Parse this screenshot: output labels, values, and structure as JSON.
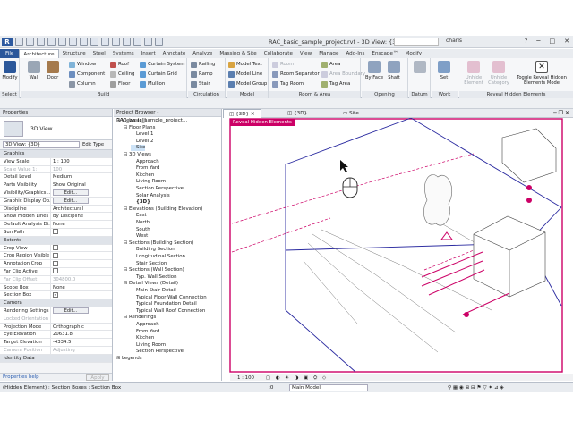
{
  "window": {
    "title": "RAC_basic_sample_project.rvt - 3D View: {3D}",
    "user": "charls",
    "search_placeholder": ""
  },
  "tabs": [
    "File",
    "Architecture",
    "Structure",
    "Steel",
    "Systems",
    "Insert",
    "Annotate",
    "Analyze",
    "Massing & Site",
    "Collaborate",
    "View",
    "Manage",
    "Add-Ins",
    "Enscape™",
    "Modify"
  ],
  "ribbon": {
    "select_panel": {
      "modify": "Modify",
      "select": "Select ▾"
    },
    "build": {
      "label": "Build",
      "wall": "Wall",
      "door": "Door",
      "window": "Window",
      "component": "Component",
      "column": "Column",
      "roof": "Roof",
      "ceiling": "Ceiling",
      "floor": "Floor",
      "curtain_system": "Curtain System",
      "curtain_grid": "Curtain Grid",
      "mullion": "Mullion"
    },
    "circulation": {
      "label": "Circulation",
      "railing": "Railing",
      "ramp": "Ramp",
      "stair": "Stair"
    },
    "model": {
      "label": "Model",
      "text": "Model Text",
      "line": "Model Line",
      "group": "Model Group"
    },
    "room_area": {
      "label": "Room & Area",
      "room": "Room",
      "room_separator": "Room Separator",
      "tag_room": "Tag Room",
      "area": "Area",
      "area_boundary": "Area Boundary",
      "tag_area": "Tag Area"
    },
    "opening": {
      "label": "Opening",
      "by_face": "By Face",
      "shaft": "Shaft"
    },
    "datum": {
      "label": "Datum"
    },
    "work_plane": {
      "label": "Work Plane",
      "set": "Set"
    },
    "reveal": {
      "label": "Reveal Hidden Elements",
      "unhide_element": "Unhide Element",
      "unhide_category": "Unhide Category",
      "toggle": "Toggle Reveal Hidden Elements Mode"
    }
  },
  "properties": {
    "title": "Properties",
    "type_name": "3D View",
    "selector": "3D View: {3D}",
    "edit_type": "Edit Type",
    "rows": [
      {
        "k": "Graphics",
        "section": true
      },
      {
        "k": "View Scale",
        "v": "1 : 100"
      },
      {
        "k": "Scale Value    1:",
        "v": "100",
        "grey": true
      },
      {
        "k": "Detail Level",
        "v": "Medium"
      },
      {
        "k": "Parts Visibility",
        "v": "Show Original"
      },
      {
        "k": "Visibility/Graphics ...",
        "v": "Edit...",
        "btn": true
      },
      {
        "k": "Graphic Display Op...",
        "v": "Edit...",
        "btn": true
      },
      {
        "k": "Discipline",
        "v": "Architectural"
      },
      {
        "k": "Show Hidden Lines",
        "v": "By Discipline"
      },
      {
        "k": "Default Analysis Di...",
        "v": "None"
      },
      {
        "k": "Sun Path",
        "cb": false
      },
      {
        "k": "Extents",
        "section": true
      },
      {
        "k": "Crop View",
        "cb": false
      },
      {
        "k": "Crop Region Visible",
        "cb": false
      },
      {
        "k": "Annotation Crop",
        "cb": false
      },
      {
        "k": "Far Clip Active",
        "cb": false
      },
      {
        "k": "Far Clip Offset",
        "v": "304800.0",
        "grey": true
      },
      {
        "k": "Scope Box",
        "v": "None"
      },
      {
        "k": "Section Box",
        "cb": true
      },
      {
        "k": "Camera",
        "section": true
      },
      {
        "k": "Rendering Settings",
        "v": "Edit...",
        "btn": true
      },
      {
        "k": "Locked Orientation",
        "v": "",
        "grey": true
      },
      {
        "k": "Projection Mode",
        "v": "Orthographic"
      },
      {
        "k": "Eye Elevation",
        "v": "20631.8"
      },
      {
        "k": "Target Elevation",
        "v": "-4334.5"
      },
      {
        "k": "Camera Position",
        "v": "Adjusting",
        "grey": true
      },
      {
        "k": "Identity Data",
        "section": true
      }
    ],
    "help": "Properties help",
    "apply": "Apply"
  },
  "browser": {
    "title": "Project Browser - RAC_basic_sample_project...",
    "nodes": [
      {
        "t": "Views (all)",
        "lvl": 0,
        "tg": "⊟"
      },
      {
        "t": "Floor Plans",
        "lvl": 1,
        "tg": "⊟"
      },
      {
        "t": "Level 1",
        "lvl": 2
      },
      {
        "t": "Level 2",
        "lvl": 2
      },
      {
        "t": "Site",
        "lvl": 2,
        "sel": true
      },
      {
        "t": "3D Views",
        "lvl": 1,
        "tg": "⊟"
      },
      {
        "t": "Approach",
        "lvl": 2
      },
      {
        "t": "From Yard",
        "lvl": 2
      },
      {
        "t": "Kitchen",
        "lvl": 2
      },
      {
        "t": "Living Room",
        "lvl": 2
      },
      {
        "t": "Section Perspective",
        "lvl": 2
      },
      {
        "t": "Solar Analysis",
        "lvl": 2
      },
      {
        "t": "{3D}",
        "lvl": 2,
        "bold": true
      },
      {
        "t": "Elevations (Building Elevation)",
        "lvl": 1,
        "tg": "⊟"
      },
      {
        "t": "East",
        "lvl": 2
      },
      {
        "t": "North",
        "lvl": 2
      },
      {
        "t": "South",
        "lvl": 2
      },
      {
        "t": "West",
        "lvl": 2
      },
      {
        "t": "Sections (Building Section)",
        "lvl": 1,
        "tg": "⊟"
      },
      {
        "t": "Building Section",
        "lvl": 2
      },
      {
        "t": "Longitudinal Section",
        "lvl": 2
      },
      {
        "t": "Stair Section",
        "lvl": 2
      },
      {
        "t": "Sections (Wall Section)",
        "lvl": 1,
        "tg": "⊟"
      },
      {
        "t": "Typ. Wall Section",
        "lvl": 2
      },
      {
        "t": "Detail Views (Detail)",
        "lvl": 1,
        "tg": "⊟"
      },
      {
        "t": "Main Stair Detail",
        "lvl": 2
      },
      {
        "t": "Typical Floor Wall Connection",
        "lvl": 2
      },
      {
        "t": "Typical Foundation Detail",
        "lvl": 2
      },
      {
        "t": "Typical Wall Roof Connection",
        "lvl": 2
      },
      {
        "t": "Renderings",
        "lvl": 1,
        "tg": "⊟"
      },
      {
        "t": "Approach",
        "lvl": 2
      },
      {
        "t": "From Yard",
        "lvl": 2
      },
      {
        "t": "Kitchen",
        "lvl": 2
      },
      {
        "t": "Living Room",
        "lvl": 2
      },
      {
        "t": "Section Perspective",
        "lvl": 2
      },
      {
        "t": "Legends",
        "lvl": 0,
        "tg": "⊞"
      }
    ]
  },
  "view_tabs": [
    "{3D}",
    "{3D}",
    "Site"
  ],
  "canvas": {
    "reveal_label": "Reveal Hidden Elements"
  },
  "view_control": {
    "scale": "1 : 100"
  },
  "status": {
    "text": "(Hidden Element) : Section Boxes : Section Box",
    "zero": ":0",
    "model": "Main Model"
  },
  "colors": {
    "reveal": "#cc0066",
    "box": "#2a2aa0",
    "file_tab": "#2b579a"
  }
}
